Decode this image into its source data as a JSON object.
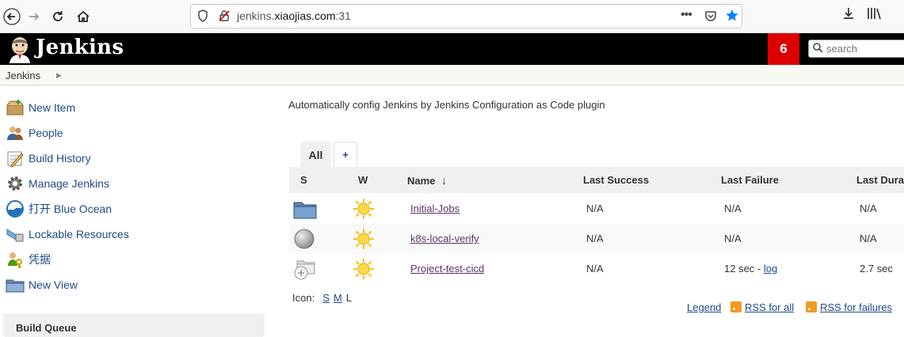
{
  "browser": {
    "url_prefix": "jenkins.",
    "url_domain": "xiaojias.com",
    "url_suffix": ":31",
    "icons": [
      "back-icon",
      "forward-icon",
      "reload-icon",
      "home-icon",
      "shield-icon",
      "insecure-lock-icon",
      "more-icon",
      "pocket-icon",
      "bookmark-star-icon",
      "download-icon",
      "library-icon"
    ]
  },
  "header": {
    "brand": "Jenkins",
    "notification_count": "6",
    "search_placeholder": "search"
  },
  "breadcrumb": {
    "root": "Jenkins"
  },
  "sidebar": {
    "items": [
      {
        "label": "New Item",
        "icon": "new-item-icon"
      },
      {
        "label": "People",
        "icon": "people-icon"
      },
      {
        "label": "Build History",
        "icon": "build-history-icon"
      },
      {
        "label": "Manage Jenkins",
        "icon": "gear-icon"
      },
      {
        "label": "打开 Blue Ocean",
        "icon": "blue-ocean-icon"
      },
      {
        "label": "Lockable Resources",
        "icon": "lockable-resources-icon"
      },
      {
        "label": "凭据",
        "icon": "credentials-icon"
      },
      {
        "label": "New View",
        "icon": "folder-icon"
      }
    ],
    "build_queue_title": "Build Queue"
  },
  "main": {
    "description": "Automatically config Jenkins by Jenkins Configuration as Code plugin",
    "tabs": [
      {
        "label": "All",
        "active": true
      },
      {
        "label": "+",
        "active": false
      }
    ],
    "table": {
      "headers": {
        "s": "S",
        "w": "W",
        "name": "Name",
        "sort_arrow": "↓",
        "last_success": "Last Success",
        "last_failure": "Last Failure",
        "last_duration": "Last Dura"
      },
      "rows": [
        {
          "status_icon": "folder-icon",
          "weather_icon": "sunny-icon",
          "name": "Initial-Jobs",
          "last_success": "N/A",
          "last_failure": "N/A",
          "last_duration": "N/A"
        },
        {
          "status_icon": "grey-ball-icon",
          "weather_icon": "sunny-icon",
          "name": "k8s-local-verify",
          "last_success": "N/A",
          "last_failure": "N/A",
          "last_duration": "N/A"
        },
        {
          "status_icon": "multibranch-folder-icon",
          "weather_icon": "sunny-icon",
          "name": "Project-test-cicd",
          "last_success": "N/A",
          "last_failure_time": "12 sec",
          "last_failure_sep": " - ",
          "last_failure_log": "log",
          "last_duration": "2.7 sec"
        }
      ]
    },
    "icon_size": {
      "label": "Icon:",
      "s": "S",
      "m": "M",
      "l": "L"
    },
    "footer_links": {
      "legend": "Legend",
      "rss_all": "RSS for all",
      "rss_failures": "RSS for failures"
    }
  },
  "colors": {
    "header_bg": "#000000",
    "badge": "#dd0000",
    "link": "#204a87",
    "visited_link": "#5c3566"
  }
}
